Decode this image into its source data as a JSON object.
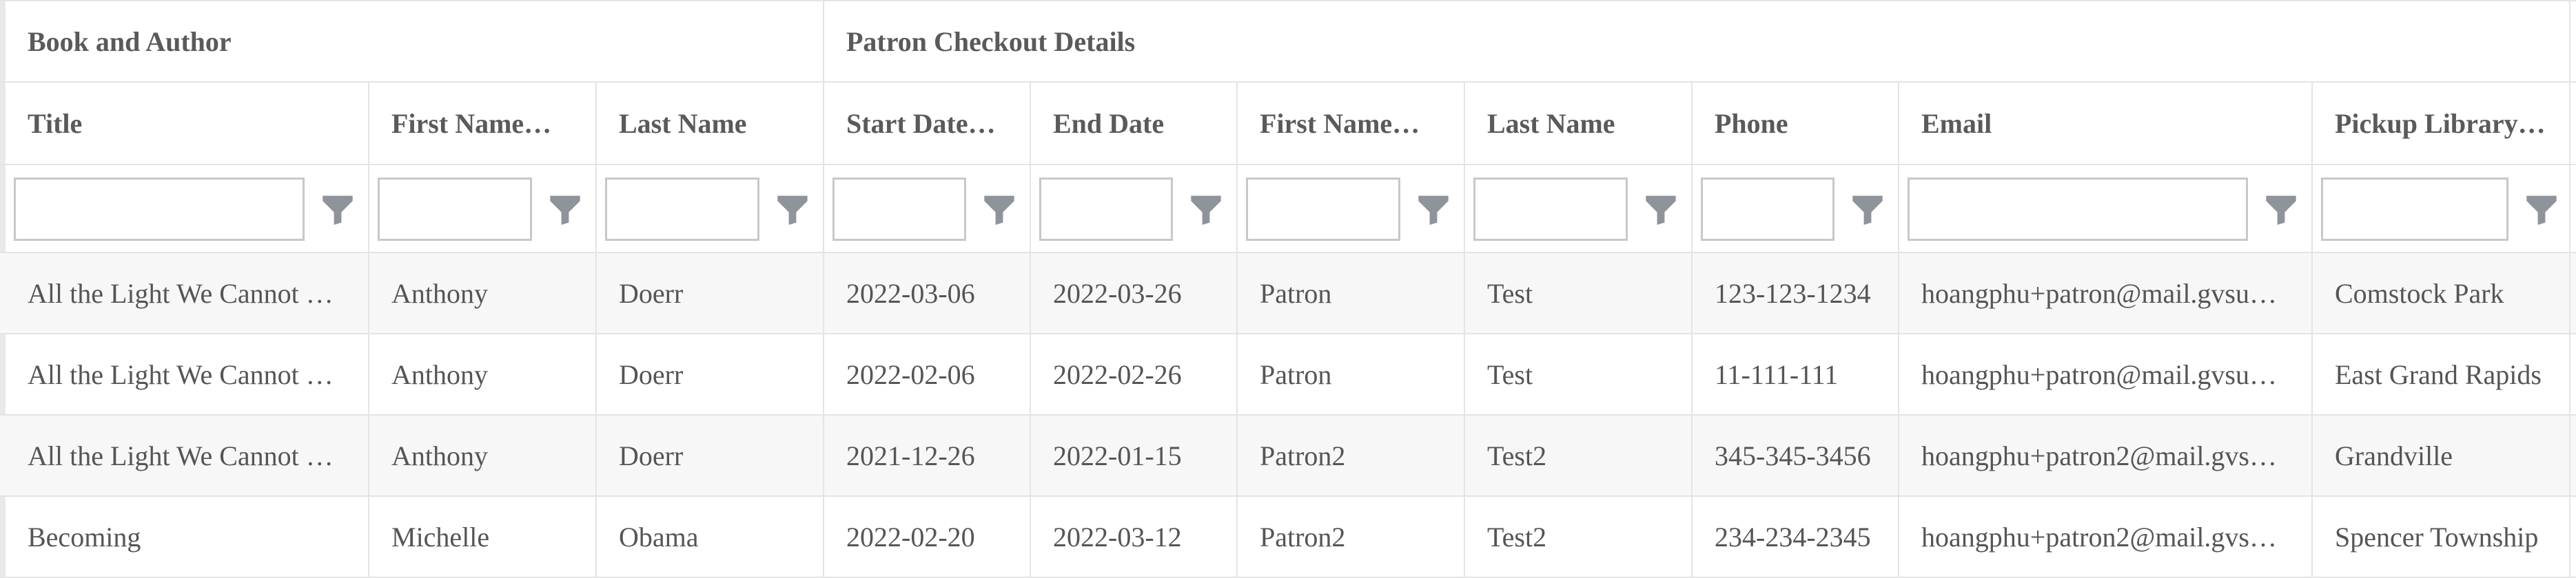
{
  "column_groups": [
    {
      "label": "Book and Author"
    },
    {
      "label": "Patron Checkout Details"
    }
  ],
  "columns": [
    {
      "key": "title",
      "label": "Title"
    },
    {
      "key": "author_first",
      "label": "First Name…"
    },
    {
      "key": "author_last",
      "label": "Last Name"
    },
    {
      "key": "start",
      "label": "Start Date…"
    },
    {
      "key": "end",
      "label": "End Date"
    },
    {
      "key": "patron_first",
      "label": "First Name…"
    },
    {
      "key": "patron_last",
      "label": "Last Name"
    },
    {
      "key": "phone",
      "label": "Phone"
    },
    {
      "key": "email",
      "label": "Email"
    },
    {
      "key": "library",
      "label": "Pickup Library…"
    }
  ],
  "filter_icon": "filter-funnel-icon",
  "rows": [
    [
      "All the Light We Cannot …",
      "Anthony",
      "Doerr",
      "2022-03-06",
      "2022-03-26",
      "Patron",
      "Test",
      "123-123-1234",
      "hoangphu+patron@mail.gvsu…",
      "Comstock Park"
    ],
    [
      "All the Light We Cannot …",
      "Anthony",
      "Doerr",
      "2022-02-06",
      "2022-02-26",
      "Patron",
      "Test",
      "11-111-111",
      "hoangphu+patron@mail.gvsu…",
      "East Grand Rapids"
    ],
    [
      "All the Light We Cannot …",
      "Anthony",
      "Doerr",
      "2021-12-26",
      "2022-01-15",
      "Patron2",
      "Test2",
      "345-345-3456",
      "hoangphu+patron2@mail.gvs…",
      "Grandville"
    ],
    [
      "Becoming",
      "Michelle",
      "Obama",
      "2022-02-20",
      "2022-03-12",
      "Patron2",
      "Test2",
      "234-234-2345",
      "hoangphu+patron2@mail.gvs…",
      "Spencer Township"
    ]
  ]
}
